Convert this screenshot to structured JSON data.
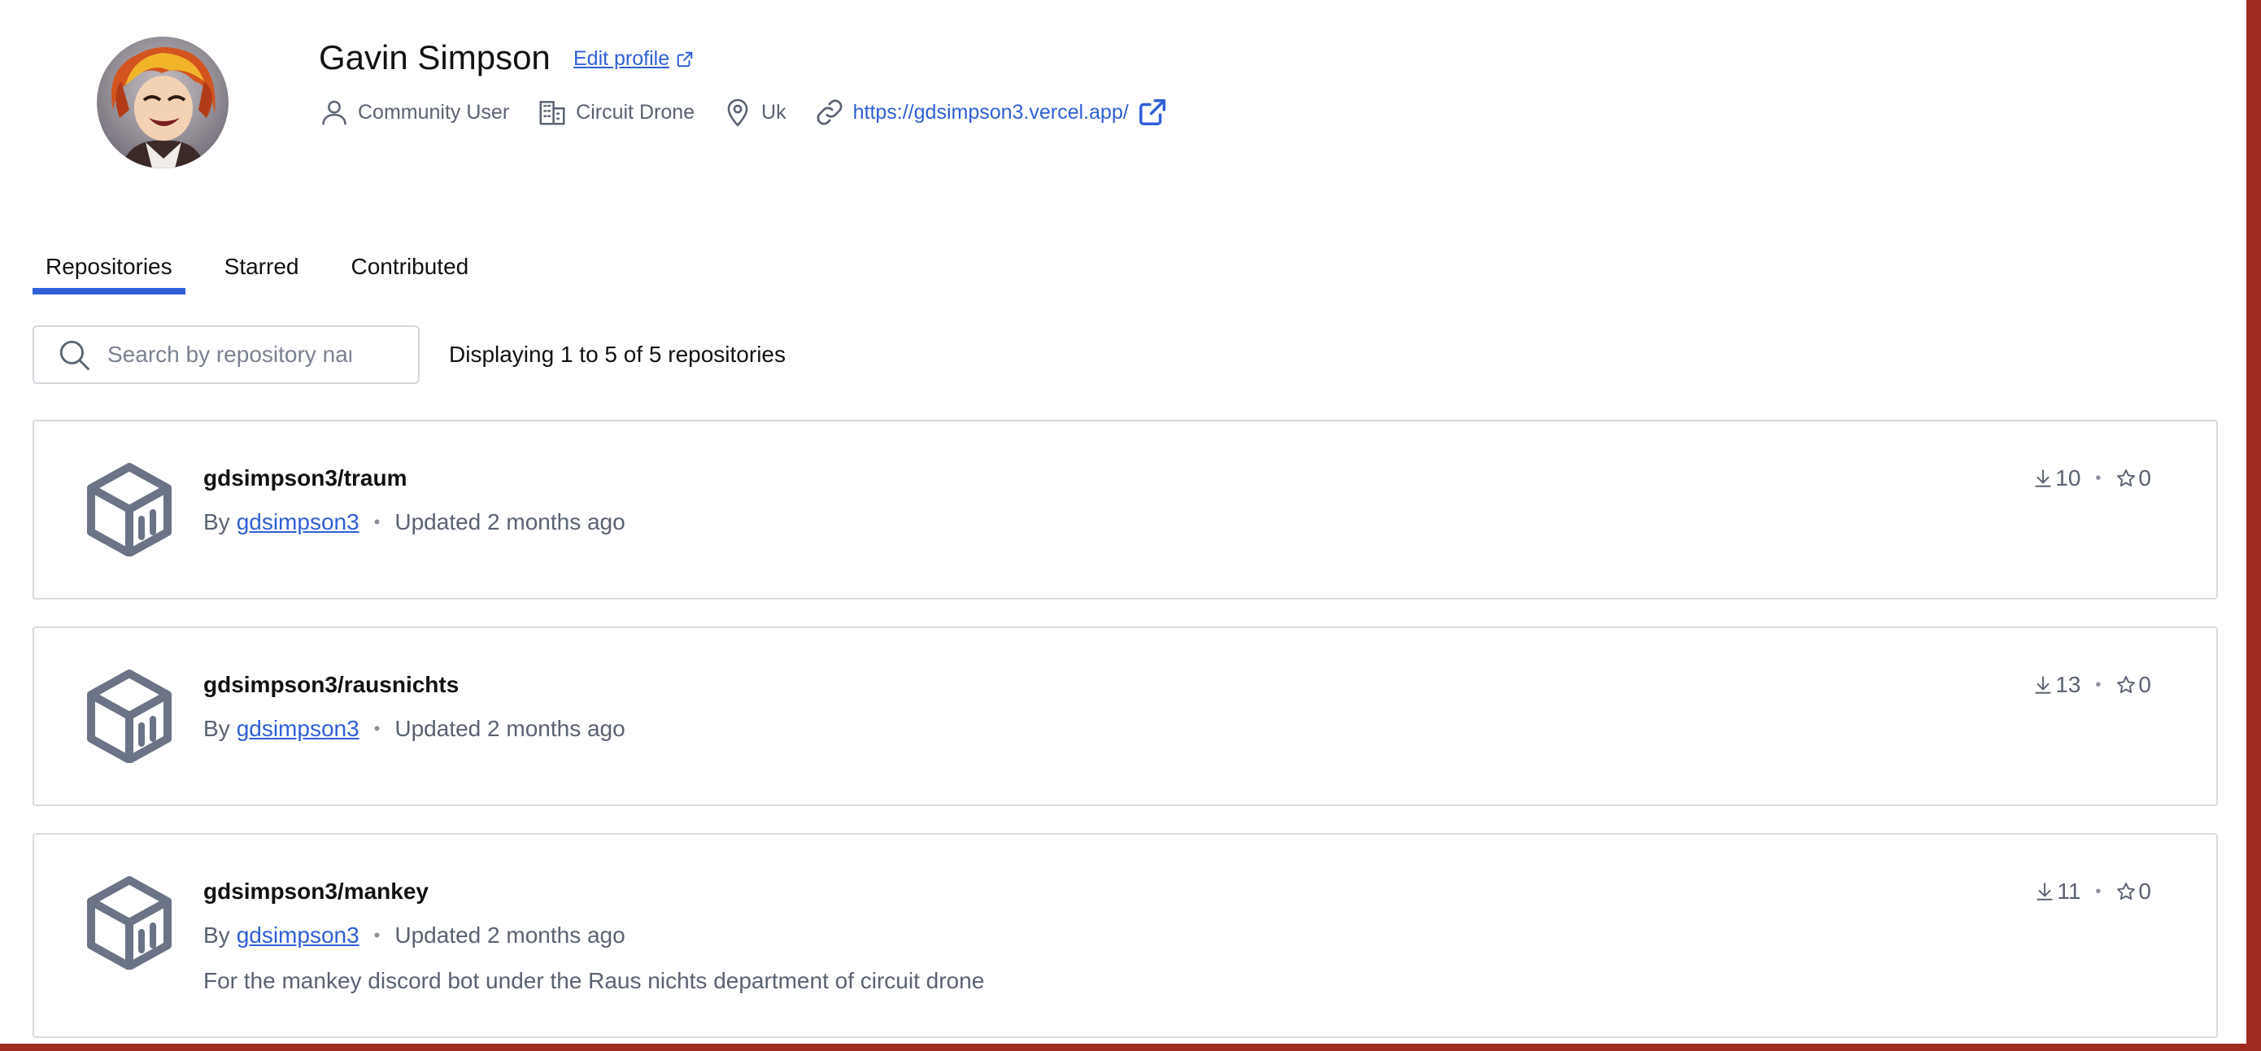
{
  "profile": {
    "name": "Gavin Simpson",
    "edit_label": "Edit profile",
    "role": "Community User",
    "organization": "Circuit Drone",
    "location": "Uk",
    "website": "https://gdsimpson3.vercel.app/"
  },
  "tabs": [
    {
      "label": "Repositories",
      "active": true
    },
    {
      "label": "Starred",
      "active": false
    },
    {
      "label": "Contributed",
      "active": false
    }
  ],
  "search": {
    "placeholder": "Search by repository name",
    "value": ""
  },
  "display_count": "Displaying 1 to 5 of 5 repositories",
  "repositories": [
    {
      "name": "gdsimpson3/traum",
      "by_label": "By",
      "owner": "gdsimpson3",
      "updated": "Updated 2 months ago",
      "downloads": "10",
      "stars": "0",
      "description": ""
    },
    {
      "name": "gdsimpson3/rausnichts",
      "by_label": "By",
      "owner": "gdsimpson3",
      "updated": "Updated 2 months ago",
      "downloads": "13",
      "stars": "0",
      "description": ""
    },
    {
      "name": "gdsimpson3/mankey",
      "by_label": "By",
      "owner": "gdsimpson3",
      "updated": "Updated 2 months ago",
      "downloads": "11",
      "stars": "0",
      "description": "For the mankey discord bot under the Raus nichts department of circuit drone"
    }
  ],
  "colors": {
    "accent": "#2f5fd6",
    "muted_text": "#5a6272",
    "border": "#d8dbe0",
    "window_frame": "#9e2b22"
  },
  "icons": {
    "avatar": "avatar-illustration",
    "user": "user-icon",
    "organization": "building-icon",
    "location": "map-pin-icon",
    "website": "link-icon",
    "external": "external-link-icon",
    "search": "search-icon",
    "repository": "cube-icon",
    "downloads": "download-icon",
    "stars": "star-icon"
  }
}
